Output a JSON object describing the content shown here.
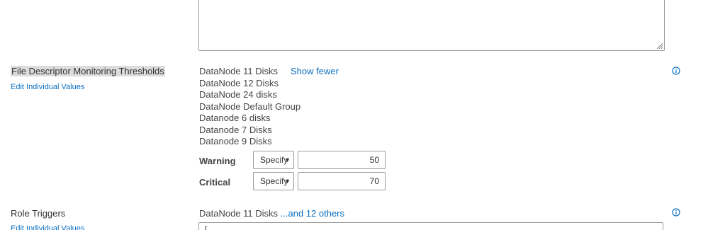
{
  "file_descriptor": {
    "title": "File Descriptor Monitoring Thresholds",
    "edit_link": "Edit Individual Values",
    "groups": [
      "DataNode 11 Disks",
      "DataNode 12 Disks",
      "DataNode 24 disks",
      "DataNode Default Group",
      "Datanode 6 disks",
      "Datanode 7 Disks",
      "Datanode 9 Disks"
    ],
    "show_fewer": "Show fewer",
    "warning": {
      "label": "Warning",
      "mode": "Specify",
      "value": "50"
    },
    "critical": {
      "label": "Critical",
      "mode": "Specify",
      "value": "70"
    }
  },
  "role_triggers": {
    "title": "Role Triggers",
    "edit_link": "Edit Individual Values",
    "group": "DataNode 11 Disks",
    "others_link": "...and 12 others",
    "value": "["
  },
  "icons": {
    "info": "info-circle-icon",
    "resize": "resize-grip-icon"
  },
  "colors": {
    "link": "#0a6fc2",
    "highlight": "#dcdcdc"
  }
}
